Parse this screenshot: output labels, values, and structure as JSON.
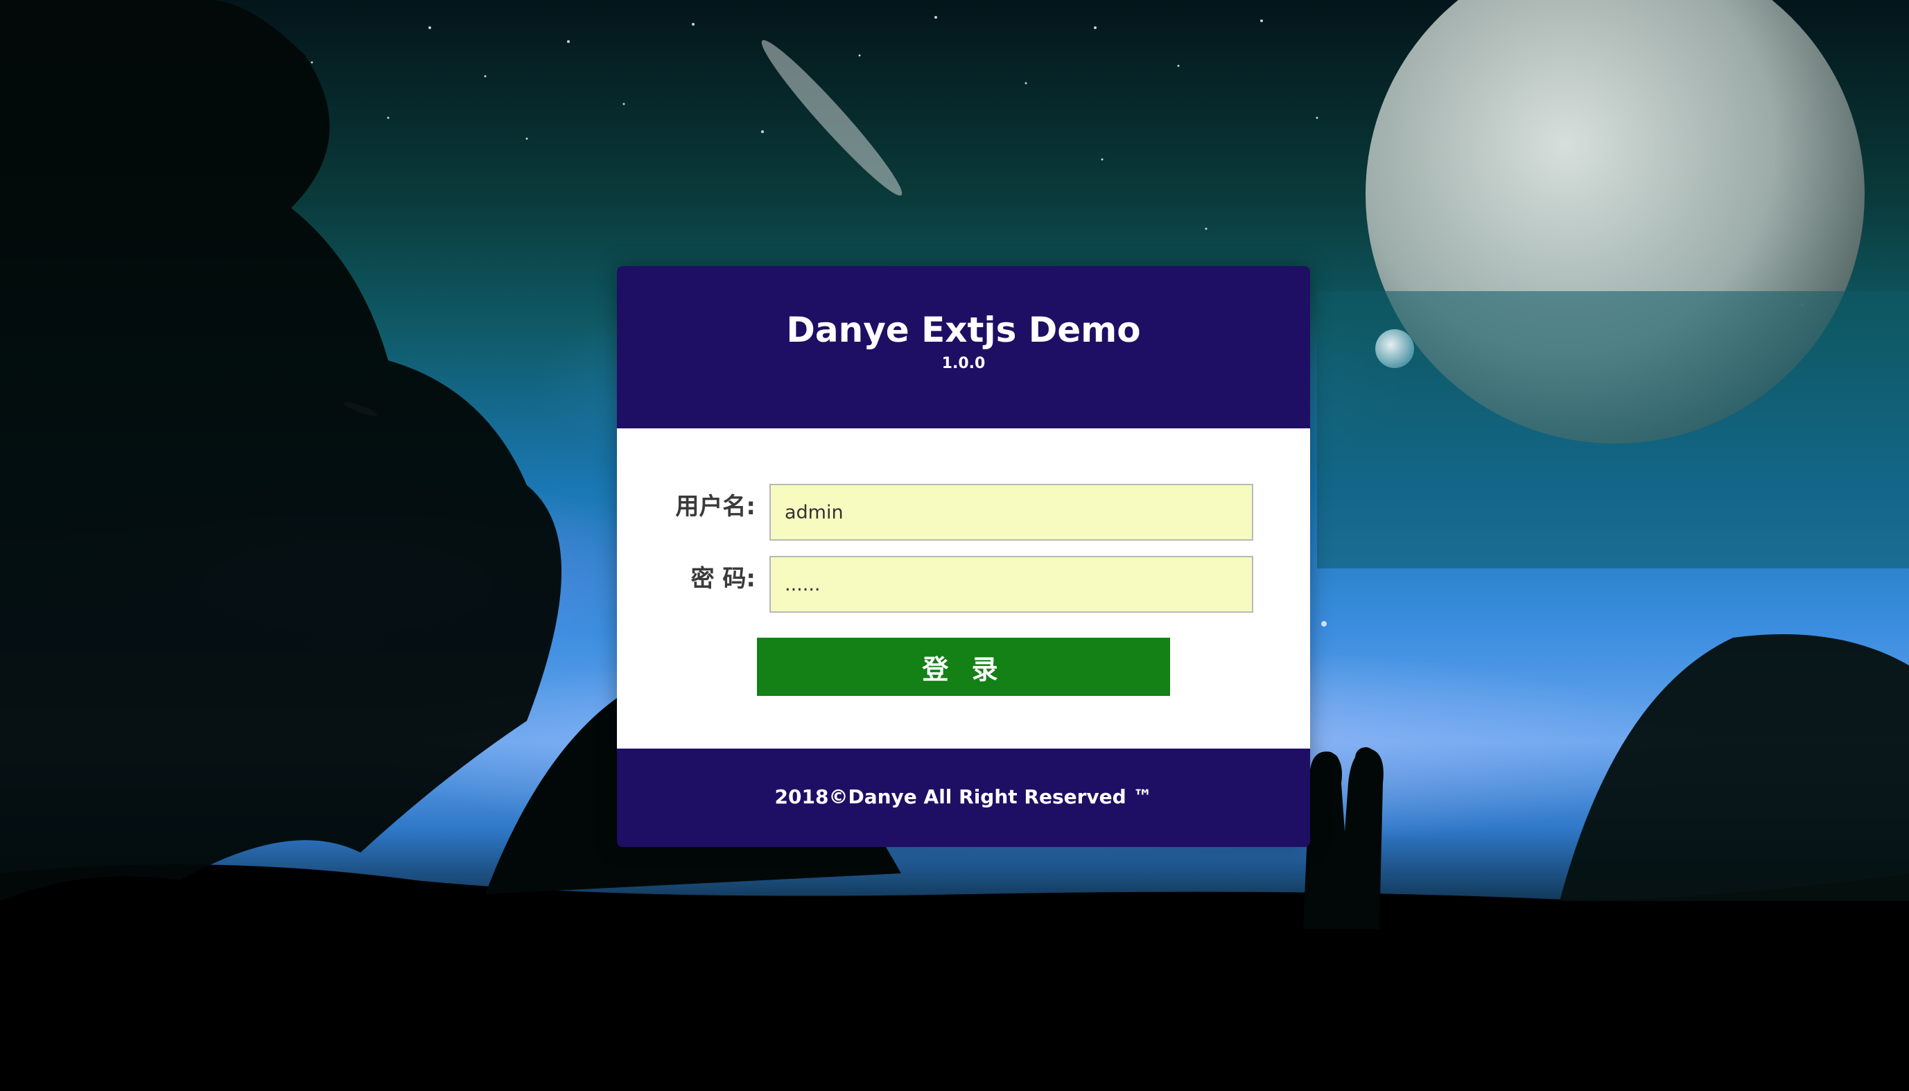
{
  "app": {
    "title": "Danye Extjs Demo",
    "version": "1.0.0"
  },
  "login_form": {
    "username_label": "用户名:",
    "username_value": "admin",
    "password_label": "密 码:",
    "password_value": "......",
    "submit_label": "登 录"
  },
  "footer": {
    "text": "2018©Danye All Right Reserved ™"
  },
  "colors": {
    "header_bg": "#1e0f64",
    "input_bg": "#f7fbc0",
    "button_bg": "#138115",
    "text_white": "#ffffff"
  },
  "background": {
    "icon": "night-sky-moon-couple-illustration"
  }
}
